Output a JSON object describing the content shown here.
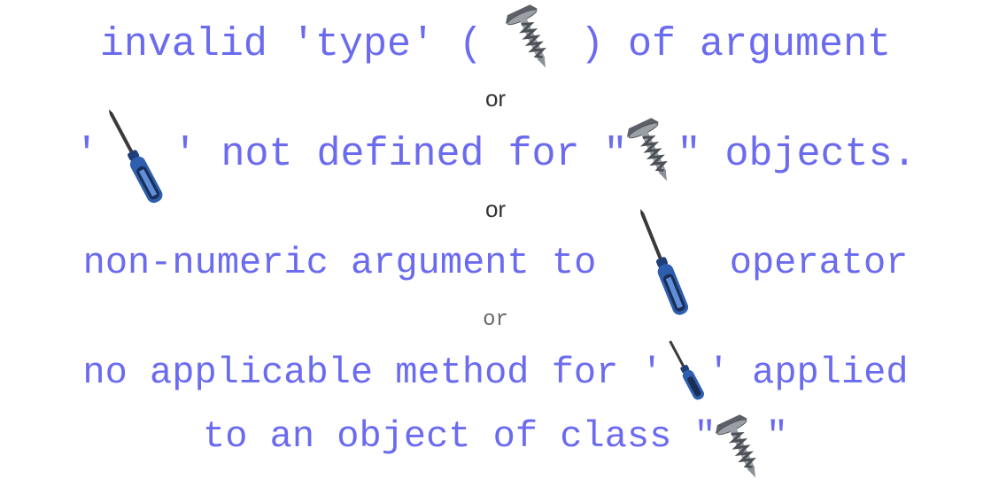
{
  "line1": {
    "before": "invalid 'type' (",
    "after": ") of argument"
  },
  "or1": "or",
  "line2": {
    "q1": "'",
    "middle": "' not defined for \"",
    "after": "\" objects."
  },
  "or2": "or",
  "line3": {
    "before": "non-numeric argument to",
    "after": "operator"
  },
  "or3": "or",
  "line4": {
    "before": "no applicable method for '",
    "after": "' applied"
  },
  "line5": {
    "before": "to an object of class \"",
    "after": "\""
  },
  "icons": {
    "screw": "screw-icon",
    "screwdriver": "screwdriver-icon"
  },
  "colors": {
    "text": "#6b6bf0",
    "or_text": "#333333",
    "screwdriver_handle": "#2d5fae",
    "screw_metal": "#8a8f95"
  }
}
